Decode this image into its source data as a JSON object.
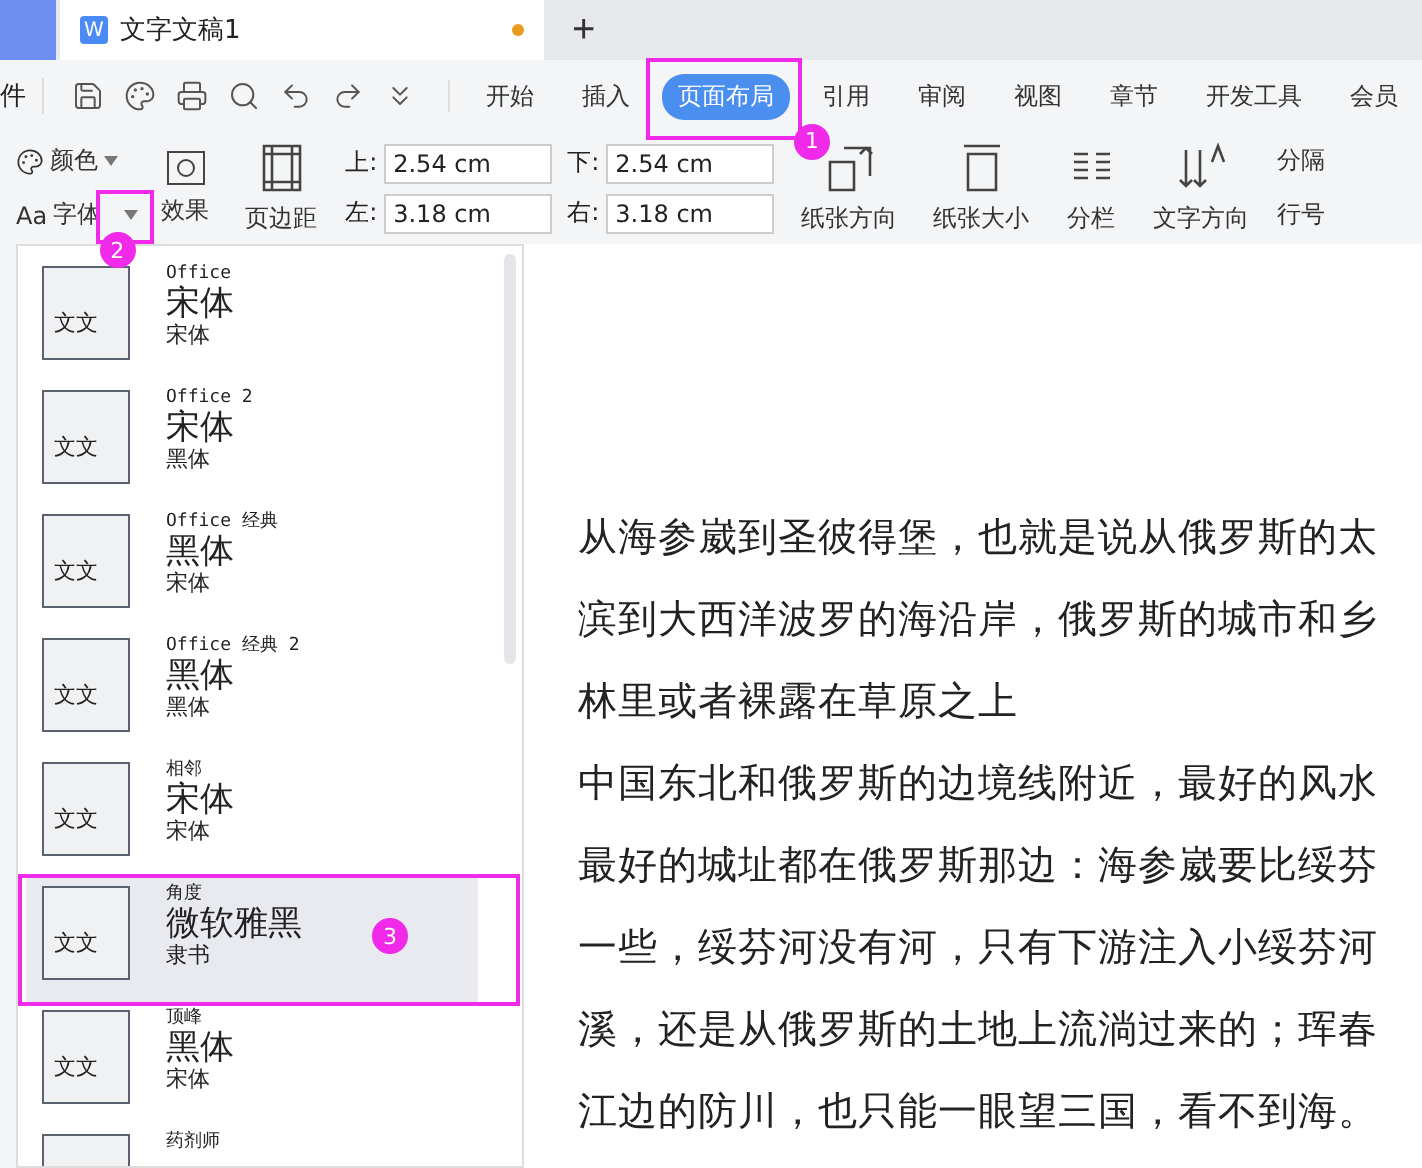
{
  "doc_tabs": [
    {
      "title": "文字文稿1",
      "app_letter": "W",
      "modified": true,
      "selected": true
    }
  ],
  "new_tab": "+",
  "menu": {
    "file": "件",
    "ribbon_tabs": [
      {
        "label": "开始",
        "selected": false
      },
      {
        "label": "插入",
        "selected": false
      },
      {
        "label": "页面布局",
        "selected": true,
        "callout": "1"
      },
      {
        "label": "引用",
        "selected": false
      },
      {
        "label": "审阅",
        "selected": false
      },
      {
        "label": "视图",
        "selected": false
      },
      {
        "label": "章节",
        "selected": false
      },
      {
        "label": "开发工具",
        "selected": false
      },
      {
        "label": "会员",
        "selected": false
      }
    ]
  },
  "ribbon": {
    "colors": "颜色",
    "fonts_icon": "Aa",
    "fonts": "字体",
    "fonts_callout": "2",
    "effects": "效果",
    "margins": "页边距",
    "margin_fields": [
      {
        "label": "上:",
        "value": "2.54 cm"
      },
      {
        "label": "下:",
        "value": "2.54 cm"
      },
      {
        "label": "左:",
        "value": "3.18 cm"
      },
      {
        "label": "右:",
        "value": "3.18 cm"
      }
    ],
    "orientation": "纸张方向",
    "size": "纸张大小",
    "columns": "分栏",
    "text_direction": "文字方向",
    "breaks": "分隔",
    "line_numbers": "行号"
  },
  "font_themes": [
    {
      "thumb": "文文",
      "name": "Office",
      "heading": "宋体",
      "body": "宋体",
      "selected": false
    },
    {
      "thumb": "文文",
      "name": "Office 2",
      "heading": "宋体",
      "body": "黑体",
      "selected": false
    },
    {
      "thumb": "文文",
      "name": "Office 经典",
      "heading": "黑体",
      "body": "宋体",
      "selected": false
    },
    {
      "thumb": "文文",
      "name": "Office 经典 2",
      "heading": "黑体",
      "body": "黑体",
      "selected": false
    },
    {
      "thumb": "文文",
      "name": "相邻",
      "heading": "宋体",
      "body": "宋体",
      "selected": false
    },
    {
      "thumb": "文文",
      "name": "角度",
      "heading": "微软雅黑",
      "body": "隶书",
      "selected": true,
      "callout": "3"
    },
    {
      "thumb": "文文",
      "name": "顶峰",
      "heading": "黑体",
      "body": "宋体",
      "selected": false
    },
    {
      "name": "药剂师",
      "selected": false
    }
  ],
  "document_lines": [
    "从海参崴到圣彼得堡，也就是说从俄罗斯的太",
    "滨到大西洋波罗的海沿岸，俄罗斯的城市和乡",
    "林里或者裸露在草原之上",
    "中国东北和俄罗斯的边境线附近，最好的风水",
    "最好的城址都在俄罗斯那边：海参崴要比绥芬",
    "一些，绥芬河没有河，只有下游注入小绥芬河",
    "溪，还是从俄罗斯的土地上流淌过来的；珲春",
    "江边的防川，也只能一眼望三国，看不到海。"
  ]
}
